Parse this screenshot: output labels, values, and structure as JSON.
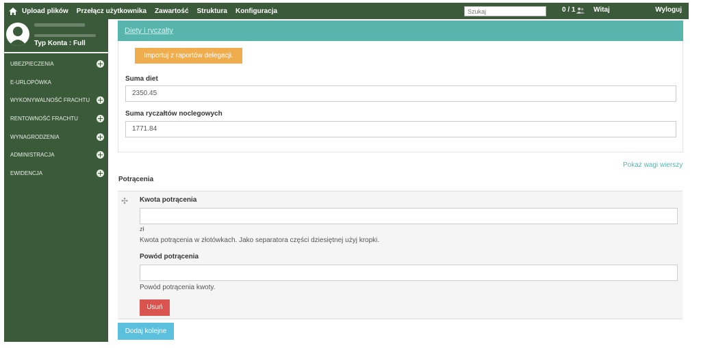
{
  "topbar": {
    "nav": [
      "Upload plików",
      "Przełącz użytkownika",
      "Zawartość",
      "Struktura",
      "Konfiguracja"
    ],
    "search_placeholder": "Szukaj",
    "counter": "0 / 1",
    "greeting": "Witaj",
    "logout": "Wyloguj"
  },
  "sidebar": {
    "account_type": "Typ Konta : Full",
    "items": [
      {
        "label": "UBEZPIECZENIA",
        "expandable": true
      },
      {
        "label": "E-URLOPÓWKA",
        "expandable": false
      },
      {
        "label": "WYKONYWALNOŚĆ FRACHTU",
        "expandable": true
      },
      {
        "label": "RENTOWNOŚĆ FRACHTU",
        "expandable": true
      },
      {
        "label": "WYNAGRODZENIA",
        "expandable": true
      },
      {
        "label": "ADMINISTRACJA",
        "expandable": true
      },
      {
        "label": "EWIDENCJA",
        "expandable": true
      }
    ]
  },
  "diety": {
    "title": "Diety i ryczałty",
    "import_button": "Importuj z raportów delegacji.",
    "suma_diet_label": "Suma diet",
    "suma_diet_value": "2350.45",
    "suma_ryczaltow_label": "Suma ryczałtów noclegowych",
    "suma_ryczaltow_value": "1771.84"
  },
  "potracenia": {
    "show_weights_link": "Pokaż wagi wierszy",
    "title": "Potrącenia",
    "kwota_label": "Kwota potrącenia",
    "kwota_value": "",
    "currency_suffix": "zł",
    "kwota_help": "Kwota potrącenia w złotówkach. Jako separatora części dziesiętnej użyj kropki.",
    "powod_label": "Powód potrącenia",
    "powod_value": "",
    "powod_help": "Powód potrącenia kwoty.",
    "delete_button": "Usuń",
    "add_button": "Dodaj kolejne"
  },
  "colors": {
    "sidebar_bg": "#3b5a3a",
    "header_teal": "#57b5ae",
    "import_orange": "#f0ad4e",
    "delete_red": "#d9534f",
    "add_blue": "#5bc0de"
  }
}
